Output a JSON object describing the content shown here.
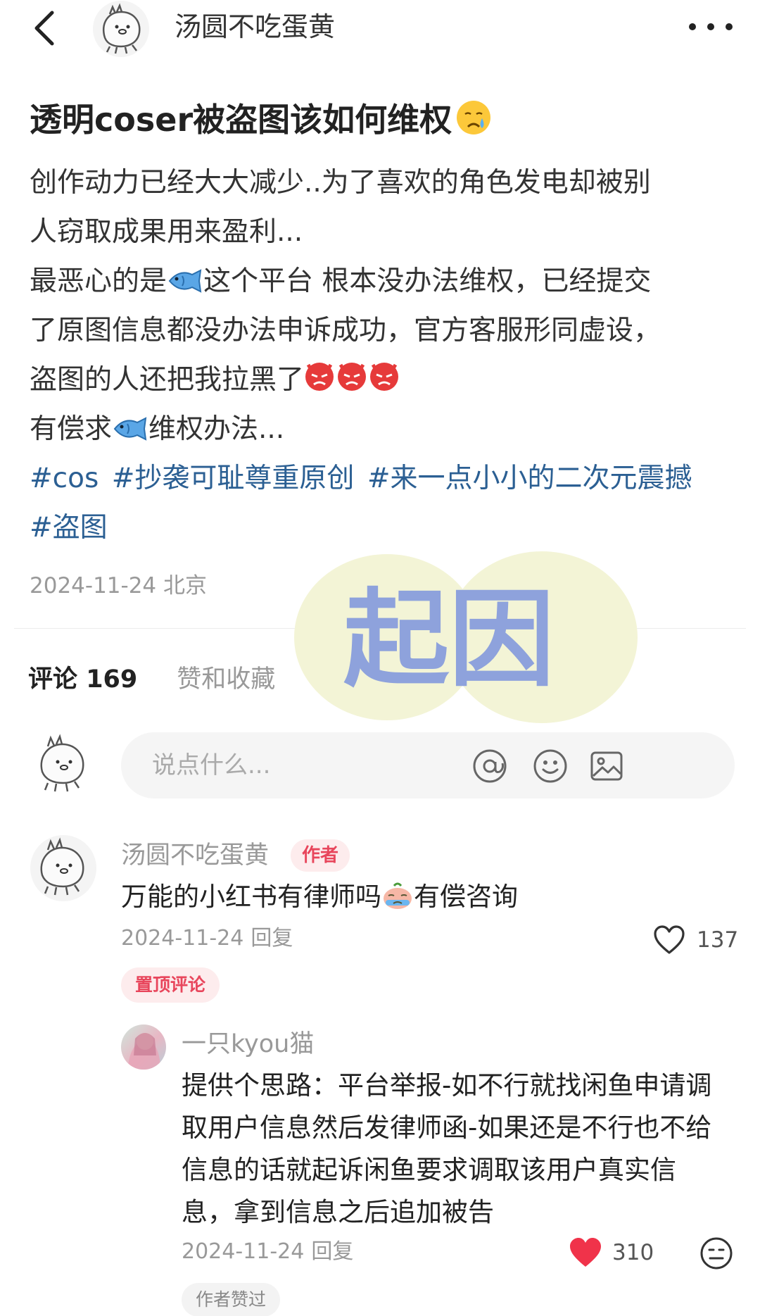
{
  "header": {
    "back_icon": "chevron-left-icon",
    "author_name": "汤圆不吃蛋黄",
    "more_icon": "more-horizontal-icon"
  },
  "post": {
    "title": "透明coser被盗图该如何维权",
    "title_emoji": "crying-face-icon",
    "body": {
      "line1": "创作动力已经大大减少..为了喜欢的角色发电却被别",
      "line2": "人窃取成果用来盈利...",
      "line3_before": "最恶心的是",
      "line3_after": "这个平台 根本没办法维权，已经提交",
      "line4": "了原图信息都没办法申诉成功，官方客服形同虚设，",
      "line5": "盗图的人还把我拉黑了",
      "line6_before": "有偿求",
      "line6_after": "维权办法..."
    },
    "tags": [
      "#cos",
      "#抄袭可耻尊重原创",
      "#来一点小小的二次元震撼",
      "#盗图"
    ],
    "date": "2024-11-24",
    "location": "北京"
  },
  "tabs": {
    "comments_label": "评论",
    "comments_count": "169",
    "likes_label": "赞和收藏"
  },
  "sticker_text": "起因",
  "comment_input": {
    "placeholder": "说点什么...",
    "icons": [
      "at-icon",
      "emoji-icon",
      "image-icon"
    ]
  },
  "comments": [
    {
      "author": "汤圆不吃蛋黄",
      "author_badge": "作者",
      "text_before": "万能的小红书有律师吗",
      "text_after": "有偿咨询",
      "date": "2024-11-24",
      "reply_label": "回复",
      "likes": "137",
      "pinned_label": "置顶评论",
      "reply": {
        "author": "一只kyou猫",
        "lines": [
          "提供个思路：平台举报-如不行就找闲鱼申请调",
          "取用户信息然后发律师函-如果还是不行也不给",
          "信息的话就起诉闲鱼要求调取该用户真实信",
          "息，拿到信息之后追加被告"
        ],
        "date": "2024-11-24",
        "reply_label": "回复",
        "likes": "310",
        "liked_by_author": "作者赞过"
      }
    }
  ],
  "colors": {
    "tag_blue": "#2b5f93",
    "badge_red": "#e8465c",
    "heart_red": "#f0334a",
    "sticker_blob": "#f3f4d6",
    "sticker_text": "#8ea2dc"
  }
}
